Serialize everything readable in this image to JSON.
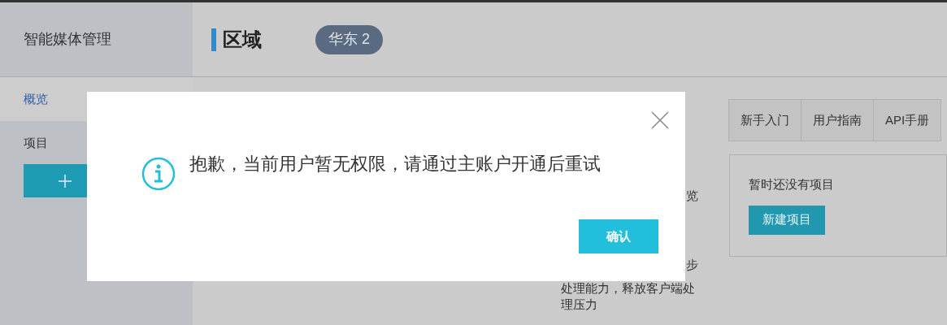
{
  "sidebar": {
    "title": "智能媒体管理",
    "items": [
      {
        "label": "概览",
        "selected": true
      },
      {
        "label": "项目",
        "selected": false
      }
    ]
  },
  "header": {
    "title": "区域",
    "region": "华东 2"
  },
  "links": [
    "新手入门",
    "用户指南",
    "API手册"
  ],
  "projects": {
    "empty_text": "暂时还没有项目",
    "button": "新建项目"
  },
  "background_text": {
    "fragment_1": "览",
    "fragment_2": "步",
    "lines": [
      "处理能力，释放客户端处",
      "理压力"
    ]
  },
  "dialog": {
    "message": "抱歉，当前用户暂无权限，请通过主账户开通后重试",
    "button": "确认"
  }
}
